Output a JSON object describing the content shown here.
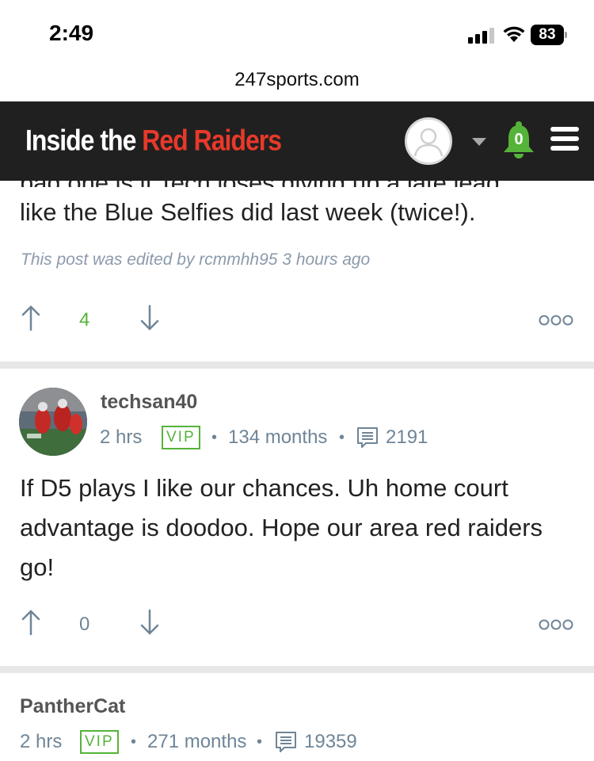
{
  "status_bar": {
    "time": "2:49",
    "battery": "83"
  },
  "url_bar": {
    "domain": "247sports.com"
  },
  "site_header": {
    "logo_part1": "Inside the ",
    "logo_part2": "Red Raiders",
    "notification_count": "0",
    "colors": {
      "background": "#202020",
      "accent_red": "#e8392a",
      "bell_green": "#56b33a"
    }
  },
  "posts": [
    {
      "body_cut_line": "bad one is if Tech loses giving up a late lead",
      "body": "like the Blue Selfies did last week (twice!).",
      "edited_note": "This post was edited by rcmmhh95 3 hours ago",
      "votes": "4",
      "vote_color": "#56b33a"
    },
    {
      "username": "techsan40",
      "time_ago": "2 hrs",
      "badge": "VIP",
      "tenure": "134 months",
      "post_count": "2191",
      "body": "If D5 plays I like our chances. Uh home court advantage is doodoo. Hope our area red raiders go!",
      "votes": "0"
    },
    {
      "username": "PantherCat",
      "time_ago": "2 hrs",
      "badge": "VIP",
      "tenure": "271 months",
      "post_count": "19359"
    }
  ],
  "icons": {
    "upvote": "arrow-up-icon",
    "downvote": "arrow-down-icon",
    "more": "more-options-icon",
    "posts": "comment-icon"
  }
}
